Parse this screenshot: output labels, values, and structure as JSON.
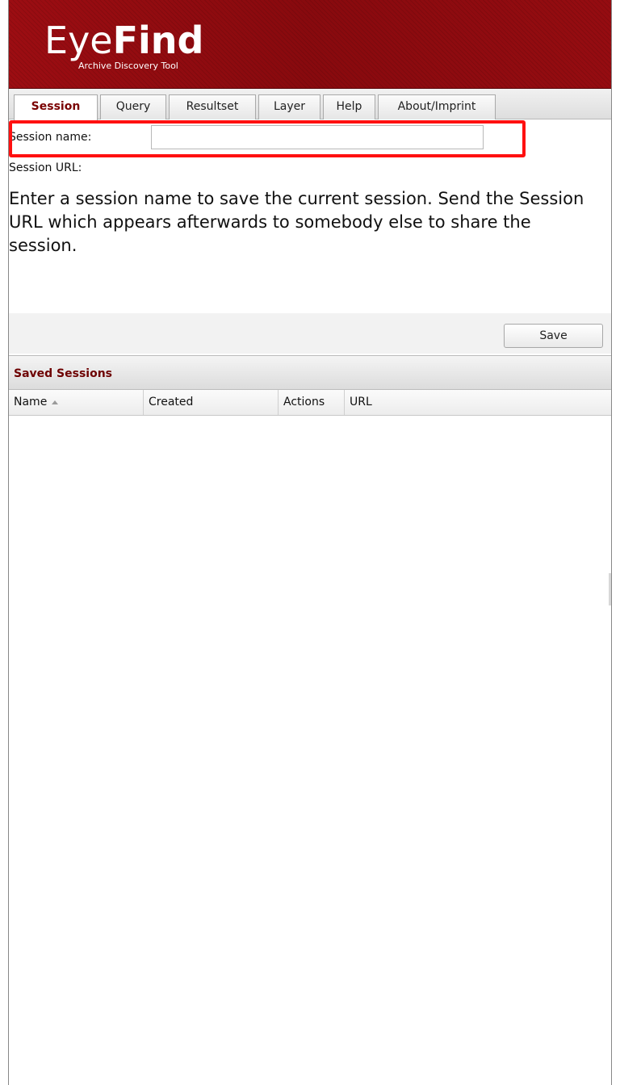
{
  "header": {
    "logo_part1": "Eye",
    "logo_part2": "Find",
    "subtitle": "Archive Discovery Tool"
  },
  "tabs": [
    {
      "label": "Session",
      "active": true
    },
    {
      "label": "Query",
      "active": false
    },
    {
      "label": "Resultset",
      "active": false
    },
    {
      "label": "Layer",
      "active": false
    },
    {
      "label": "Help",
      "active": false
    },
    {
      "label": "About/Imprint",
      "active": false
    }
  ],
  "session_form": {
    "name_label": "Session name:",
    "name_value": "",
    "url_label": "Session URL:",
    "help_text": "Enter a session name to save the current session. Send the Session URL which appears afterwards to somebody else to share the session."
  },
  "toolbar": {
    "save_label": "Save"
  },
  "saved_sessions": {
    "title": "Saved Sessions",
    "columns": [
      {
        "label": "Name",
        "sorted": "asc"
      },
      {
        "label": "Created"
      },
      {
        "label": "Actions"
      },
      {
        "label": "URL"
      }
    ],
    "rows": []
  },
  "colors": {
    "header_red": "#8d0a0f",
    "accent_dark_red": "#6d0000",
    "highlight": "#ff1010"
  }
}
